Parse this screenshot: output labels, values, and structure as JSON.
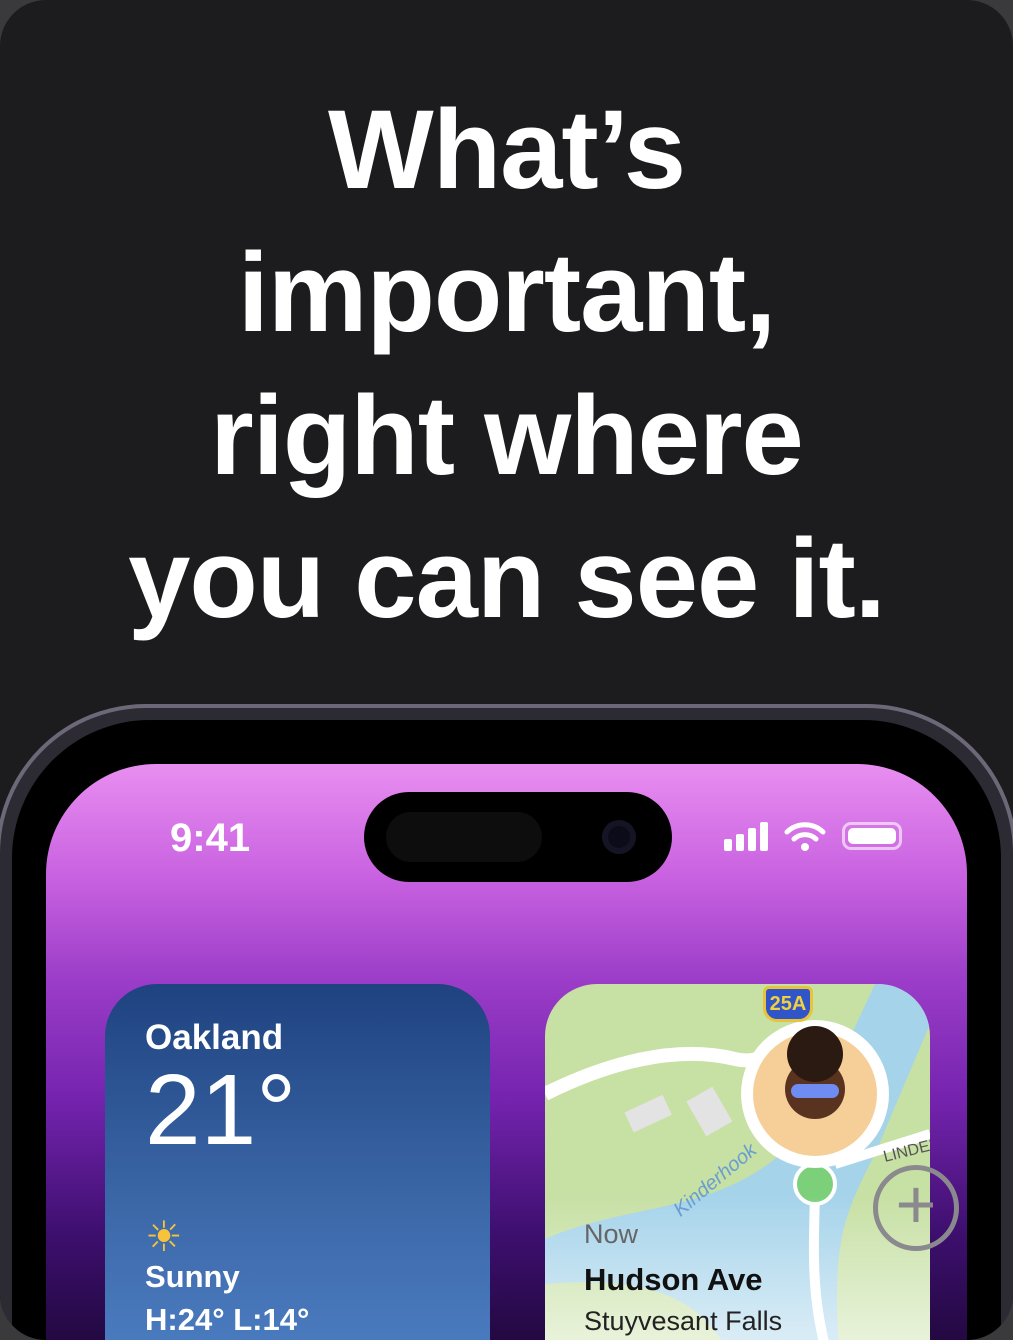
{
  "headline": [
    "What’s",
    "important,",
    "right where",
    "you can see it."
  ],
  "status_bar": {
    "time": "9:41",
    "icons": [
      "cellular-signal-icon",
      "wifi-icon",
      "battery-icon"
    ]
  },
  "weather_widget": {
    "city": "Oakland",
    "temperature": "21°",
    "icon": "sun-icon",
    "condition": "Sunny",
    "high_low": "H:24° L:14°"
  },
  "find_my_widget": {
    "route_shield": "25A",
    "road_label": "LINDEN",
    "river_label": "Kinderhook",
    "time_label": "Now",
    "street": "Hudson Ave",
    "place": "Stuyvesant Falls"
  },
  "add_button_icon": "plus-circle-icon"
}
